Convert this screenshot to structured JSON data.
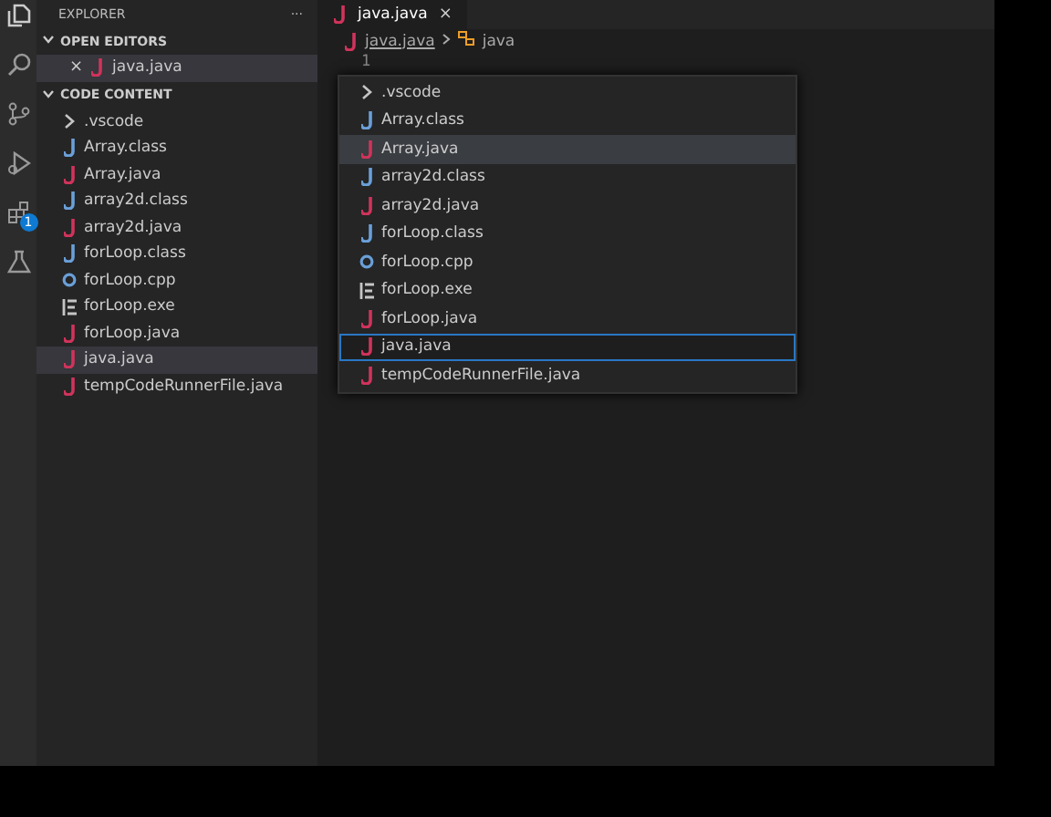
{
  "sidebar": {
    "title": "EXPLORER",
    "more": "···",
    "sections": [
      {
        "title": "OPEN EDITORS",
        "expanded": true,
        "items": [
          {
            "name": "java.java",
            "kind": "java",
            "close": "×",
            "selected": true
          }
        ]
      },
      {
        "title": "CODE CONTENT",
        "expanded": true,
        "items": [
          {
            "name": ".vscode",
            "kind": "folder",
            "selected": false
          },
          {
            "name": "Array.class",
            "kind": "class",
            "selected": false
          },
          {
            "name": "Array.java",
            "kind": "java",
            "selected": false
          },
          {
            "name": "array2d.class",
            "kind": "class",
            "selected": false
          },
          {
            "name": "array2d.java",
            "kind": "java",
            "selected": false
          },
          {
            "name": "forLoop.class",
            "kind": "class",
            "selected": false
          },
          {
            "name": "forLoop.cpp",
            "kind": "cpp",
            "selected": false
          },
          {
            "name": "forLoop.exe",
            "kind": "exe",
            "selected": false
          },
          {
            "name": "forLoop.java",
            "kind": "java",
            "selected": false
          },
          {
            "name": "java.java",
            "kind": "java",
            "selected": true
          },
          {
            "name": "tempCodeRunnerFile.java",
            "kind": "java",
            "selected": false
          }
        ]
      }
    ]
  },
  "activity_bar": {
    "badge": "1"
  },
  "tab": {
    "name": "java.java",
    "close": "×"
  },
  "breadcrumb": {
    "file": "java.java",
    "symbol": "java"
  },
  "editor": {
    "line_number": "1"
  },
  "picker": {
    "items": [
      {
        "name": ".vscode",
        "kind": "folder",
        "hovered": false,
        "selected": false
      },
      {
        "name": "Array.class",
        "kind": "class",
        "hovered": false,
        "selected": false
      },
      {
        "name": "Array.java",
        "kind": "java",
        "hovered": true,
        "selected": false
      },
      {
        "name": "array2d.class",
        "kind": "class",
        "hovered": false,
        "selected": false
      },
      {
        "name": "array2d.java",
        "kind": "java",
        "hovered": false,
        "selected": false
      },
      {
        "name": "forLoop.class",
        "kind": "class",
        "hovered": false,
        "selected": false
      },
      {
        "name": "forLoop.cpp",
        "kind": "cpp",
        "hovered": false,
        "selected": false
      },
      {
        "name": "forLoop.exe",
        "kind": "exe",
        "hovered": false,
        "selected": false
      },
      {
        "name": "forLoop.java",
        "kind": "java",
        "hovered": false,
        "selected": false
      },
      {
        "name": "java.java",
        "kind": "java",
        "hovered": false,
        "selected": true
      },
      {
        "name": "tempCodeRunnerFile.java",
        "kind": "java",
        "hovered": false,
        "selected": false
      }
    ]
  }
}
